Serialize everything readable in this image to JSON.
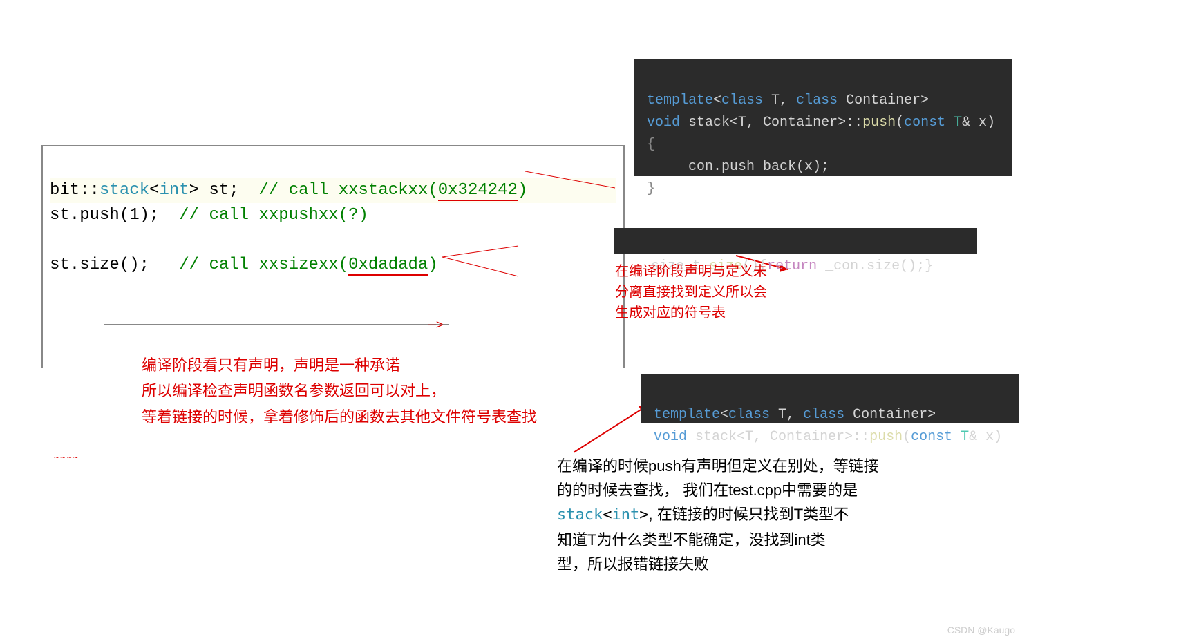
{
  "leftCode": {
    "l1_ns": "bit",
    "l1_cc1": "::",
    "l1_stack": "stack",
    "l1_ang": "<",
    "l1_int": "int",
    "l1_rest": "> st;  ",
    "l1_cmt": "// call xxstackxx(",
    "l1_cmt_addr": "0x324242",
    "l1_cmt_close": ")",
    "l2_code": "st.push(1);  ",
    "l2_cmt": "// call xxpushxx(?)",
    "l3_blank": " ",
    "l4_code": "st.size();   ",
    "l4_cmt": "// call xxsizexx(",
    "l4_cmt_addr": "0xdadada",
    "l4_cmt_close": ")"
  },
  "redNoteLeft": {
    "l1": "编译阶段看只有声明，声明是一种承诺",
    "l2": "所以编译检查声明函数名参数返回可以对上，",
    "l3": "等着链接的时候，拿着修饰后的函数去其他文件符号表查找"
  },
  "darkBox1": {
    "l1_tpl": "template",
    "l1_ang": "<",
    "l1_class1": "class",
    "l1_T": " T, ",
    "l1_class2": "class",
    "l1_Cont": " Container>",
    "l2_void": "void",
    "l2_sp": " ",
    "l2_stack": "stack",
    "l2_angs": "<T, Container>",
    "l2_cc": "::",
    "l2_push": "push",
    "l2_args": "(",
    "l2_const": "const",
    "l2_Tx": " T",
    "l2_amp": "& ",
    "l2_x": "x)",
    "l3_open": "{",
    "l4": "    _con.push_back(x);",
    "l5_close": "}"
  },
  "darkBox2": {
    "l_pre": "   size_t ",
    "l_size": "size",
    "l_mid": "(){",
    "l_ret": "return",
    "l_post": " _con.size();}"
  },
  "redNoteRight": {
    "l1": "在编译阶段声明与定义未",
    "l2": "分离直接找到定义所以会",
    "l3": "生成对应的符号表"
  },
  "darkBox3": {
    "l1_tpl": "template",
    "l1_ang": "<",
    "l1_class1": "class",
    "l1_T": " T, ",
    "l1_class2": "class",
    "l1_Cont": " Container>",
    "l2_void": "void",
    "l2_sp": " ",
    "l2_stack": "stack",
    "l2_angs": "<T, Container>",
    "l2_cc": "::",
    "l2_push": "push",
    "l2_args": "(",
    "l2_const": "const",
    "l2_Tx": " T",
    "l2_amp": "& ",
    "l2_x": "x)"
  },
  "blackNote": {
    "l1": "在编译的时候push有声明但定义在别处，等链接",
    "l2": "的的时候去查找，  我们在test.cpp中需要的是",
    "l3_code_stack": "stack",
    "l3_code_ang": "<",
    "l3_code_int": "int",
    "l3_code_close": ">",
    "l3_rest": ", 在链接的时候只找到T类型不",
    "l4": "知道T为什么类型不能确定，没找到int类",
    "l5": "型，所以报错链接失败"
  },
  "watermark": "CSDN @Kaugo",
  "tinyRed": "~~~~"
}
